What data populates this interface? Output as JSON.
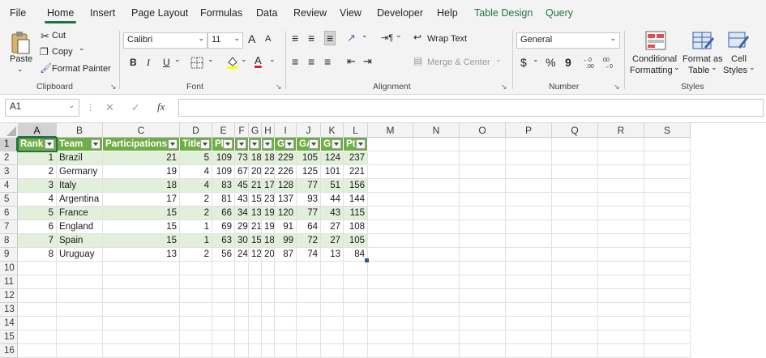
{
  "menu": {
    "items": [
      "File",
      "Home",
      "Insert",
      "Page Layout",
      "Formulas",
      "Data",
      "Review",
      "View",
      "Developer",
      "Help",
      "Table Design",
      "Query"
    ],
    "active": "Home"
  },
  "ribbon": {
    "clipboard": {
      "paste": "Paste",
      "cut": "Cut",
      "copy": "Copy",
      "format_painter": "Format Painter",
      "label": "Clipboard"
    },
    "font": {
      "family": "Calibri",
      "size": "11",
      "bold": "B",
      "italic": "I",
      "underline": "U",
      "grow": "A",
      "shrink": "A",
      "font_color": "A",
      "label": "Font"
    },
    "alignment": {
      "wrap_text": "Wrap Text",
      "merge_center": "Merge & Center",
      "label": "Alignment"
    },
    "number": {
      "format": "General",
      "currency": "$",
      "percent": "%",
      "comma": "9",
      "label": "Number"
    },
    "styles": {
      "conditional": "Conditional",
      "conditional2": "Formatting",
      "format_as": "Format as",
      "format_as2": "Table",
      "cell": "Cell",
      "cell2": "Styles",
      "label": "Styles"
    }
  },
  "formula_bar": {
    "name_box": "A1",
    "fx": "fx",
    "value": ""
  },
  "columns": [
    "A",
    "B",
    "C",
    "D",
    "E",
    "F",
    "G",
    "H",
    "I",
    "J",
    "K",
    "L",
    "M",
    "N",
    "O",
    "P",
    "Q",
    "R",
    "S"
  ],
  "rows": [
    "1",
    "2",
    "3",
    "4",
    "5",
    "6",
    "7",
    "8",
    "9",
    "10",
    "11",
    "12",
    "13",
    "14",
    "15",
    "16"
  ],
  "table": {
    "headers": [
      "Rank",
      "Team",
      "Participations",
      "Titles",
      "Pld",
      "W",
      "D",
      "L",
      "GF",
      "GA",
      "GD",
      "Pts"
    ],
    "rows": [
      [
        "1",
        "Brazil",
        "21",
        "5",
        "109",
        "73",
        "18",
        "18",
        "229",
        "105",
        "124",
        "237"
      ],
      [
        "2",
        "Germany",
        "19",
        "4",
        "109",
        "67",
        "20",
        "22",
        "226",
        "125",
        "101",
        "221"
      ],
      [
        "3",
        "Italy",
        "18",
        "4",
        "83",
        "45",
        "21",
        "17",
        "128",
        "77",
        "51",
        "156"
      ],
      [
        "4",
        "Argentina",
        "17",
        "2",
        "81",
        "43",
        "15",
        "23",
        "137",
        "93",
        "44",
        "144"
      ],
      [
        "5",
        "France",
        "15",
        "2",
        "66",
        "34",
        "13",
        "19",
        "120",
        "77",
        "43",
        "115"
      ],
      [
        "6",
        "England",
        "15",
        "1",
        "69",
        "29",
        "21",
        "19",
        "91",
        "64",
        "27",
        "108"
      ],
      [
        "7",
        "Spain",
        "15",
        "1",
        "63",
        "30",
        "15",
        "18",
        "99",
        "72",
        "27",
        "105"
      ],
      [
        "8",
        "Uruguay",
        "13",
        "2",
        "56",
        "24",
        "12",
        "20",
        "87",
        "74",
        "13",
        "84"
      ]
    ]
  },
  "colors": {
    "accent": "#217346",
    "table_header": "#70ad47",
    "table_band": "#e2efda"
  }
}
